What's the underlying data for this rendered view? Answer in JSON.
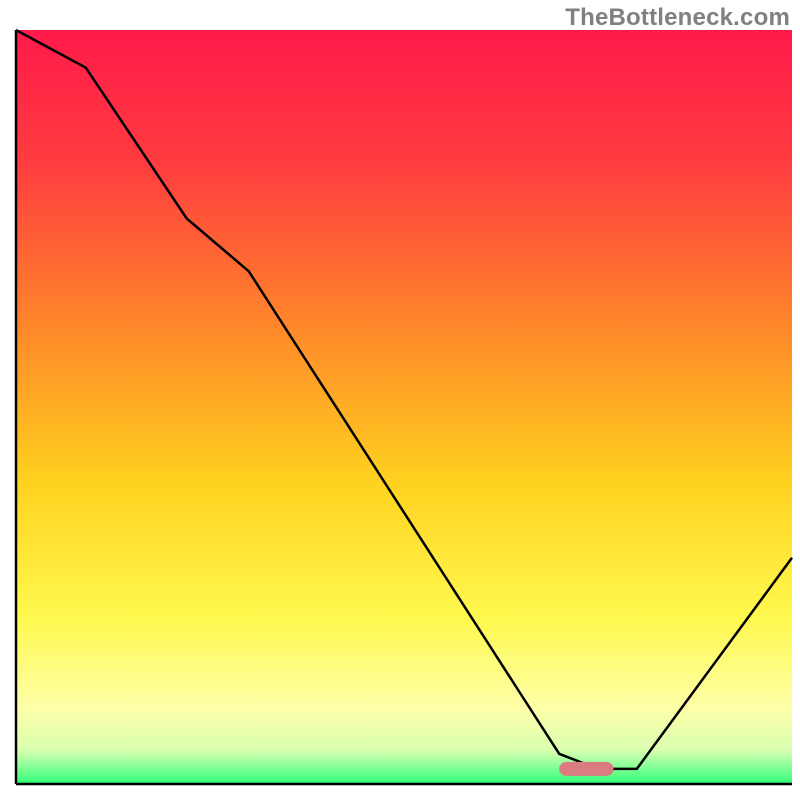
{
  "attribution": "TheBottleneck.com",
  "chart_data": {
    "type": "line",
    "title": "",
    "xlabel": "",
    "ylabel": "",
    "xlim": [
      0,
      100
    ],
    "ylim": [
      0,
      100
    ],
    "x": [
      0,
      9,
      22,
      30,
      65,
      70,
      75,
      80,
      100
    ],
    "values": [
      100,
      95,
      75,
      68,
      12,
      4,
      2,
      2,
      30
    ],
    "optimal_marker": {
      "x_start": 70,
      "x_end": 77,
      "y": 2
    },
    "background_gradient_stops": [
      {
        "pos": 0.0,
        "color": "#ff1a4a"
      },
      {
        "pos": 0.18,
        "color": "#ff3d3f"
      },
      {
        "pos": 0.4,
        "color": "#ff8a2a"
      },
      {
        "pos": 0.6,
        "color": "#ffd21f"
      },
      {
        "pos": 0.78,
        "color": "#fff94f"
      },
      {
        "pos": 0.9,
        "color": "#fdffa8"
      },
      {
        "pos": 0.955,
        "color": "#d9ffb0"
      },
      {
        "pos": 0.975,
        "color": "#8eff9a"
      },
      {
        "pos": 1.0,
        "color": "#2fff77"
      }
    ],
    "axis_color": "#000000",
    "curve_color": "#000000",
    "marker_color": "#d97b7f"
  }
}
